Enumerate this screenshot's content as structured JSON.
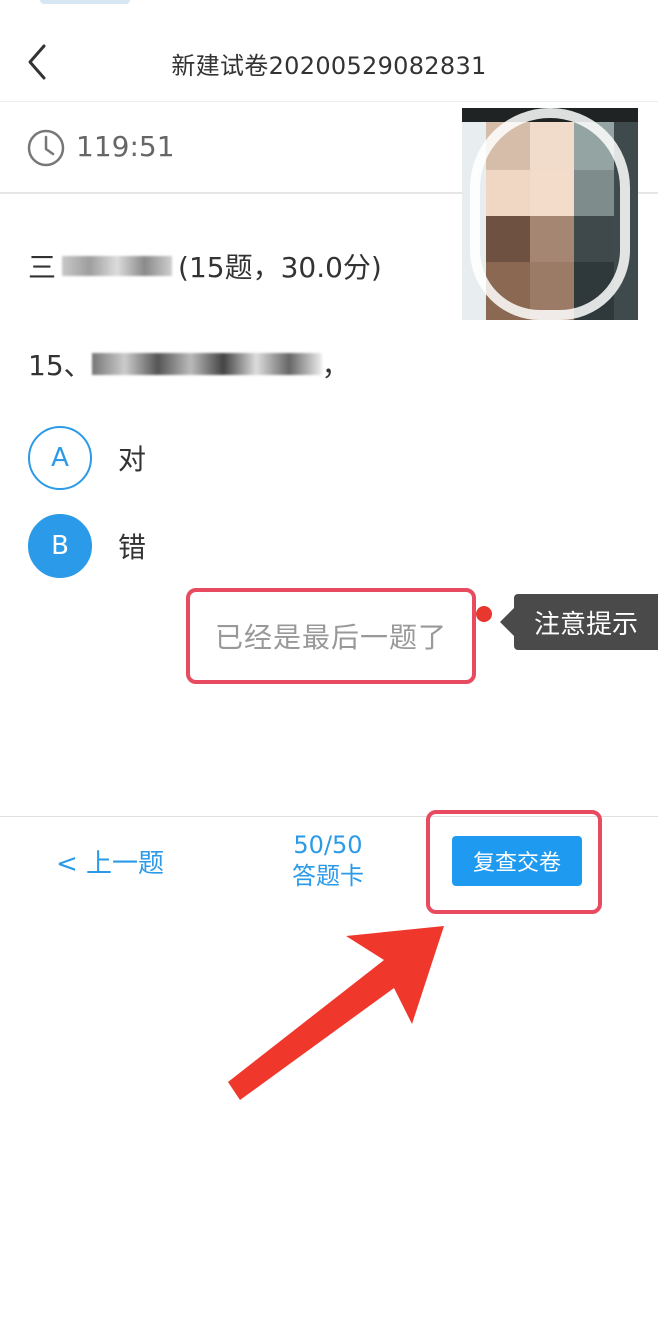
{
  "header": {
    "title": "新建试卷20200529082831"
  },
  "timer": {
    "remaining": "119:51"
  },
  "section": {
    "prefix": "三",
    "score_info": "(15题，30.0分)"
  },
  "question": {
    "number": "15、",
    "trailing": "，"
  },
  "options": [
    {
      "letter": "A",
      "text": "对",
      "selected": false
    },
    {
      "letter": "B",
      "text": "错",
      "selected": true
    }
  ],
  "toast": {
    "message": "已经是最后一题了"
  },
  "annotation": {
    "hint_label": "注意提示"
  },
  "footer": {
    "prev_label": "< 上一题",
    "progress": "50/50",
    "card_label": "答题卡",
    "submit_label": "复查交卷"
  },
  "colors": {
    "accent_blue": "#2b9ae8",
    "highlight_red": "#e84a5f",
    "arrow_red": "#f0372c"
  }
}
